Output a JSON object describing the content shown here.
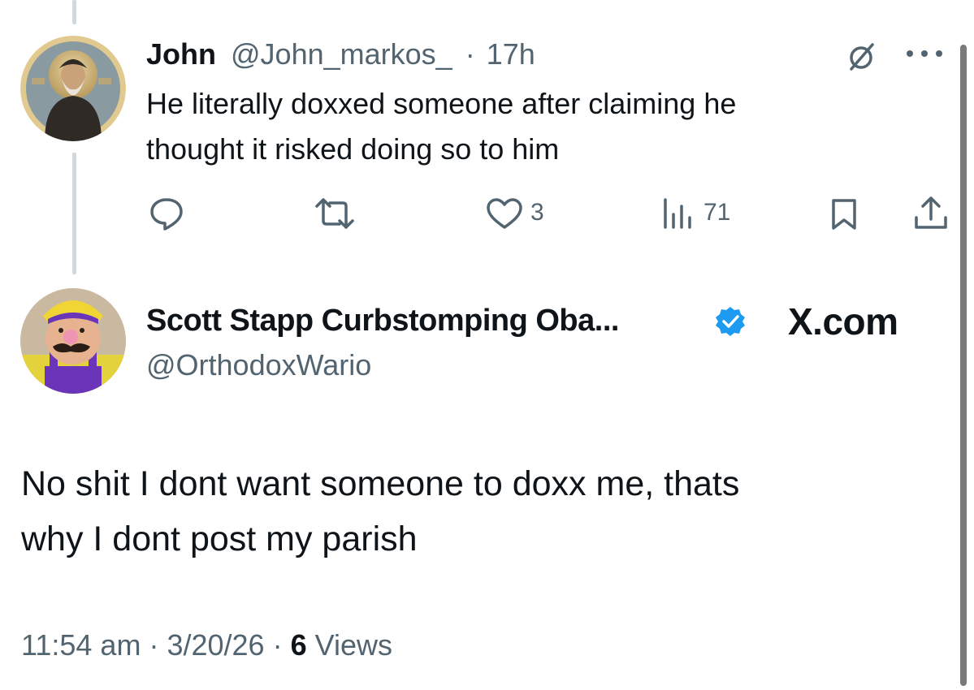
{
  "parent_tweet": {
    "display_name": "John",
    "handle": "@John_markos_",
    "separator": "·",
    "time": "17h",
    "text_line1": "He literally doxxed someone after claiming he",
    "text_line2": "thought it risked doing so to him",
    "actions": {
      "reply_icon": "reply-icon",
      "retweet_icon": "retweet-icon",
      "like_icon": "heart-icon",
      "like_count": "3",
      "views_icon": "views-icon",
      "views_count": "71",
      "bookmark_icon": "bookmark-icon",
      "share_icon": "share-icon"
    }
  },
  "main_tweet": {
    "display_name": "Scott Stapp Curbstomping Oba...",
    "handle": "@OrthodoxWario",
    "verified": true,
    "verified_color": "#1d9bf0",
    "brand": "X.com",
    "text_line1": "No shit I dont want someone to doxx me, thats",
    "text_line2": "why I dont post my parish",
    "time": "11:54 am",
    "sep1": "·",
    "date": "3/20/26",
    "sep2": "·",
    "views_count": "6",
    "views_label": "Views"
  },
  "colors": {
    "text": "#0f1419",
    "secondary": "#536471",
    "thread_line": "#cfd9de",
    "accent": "#1d9bf0"
  }
}
